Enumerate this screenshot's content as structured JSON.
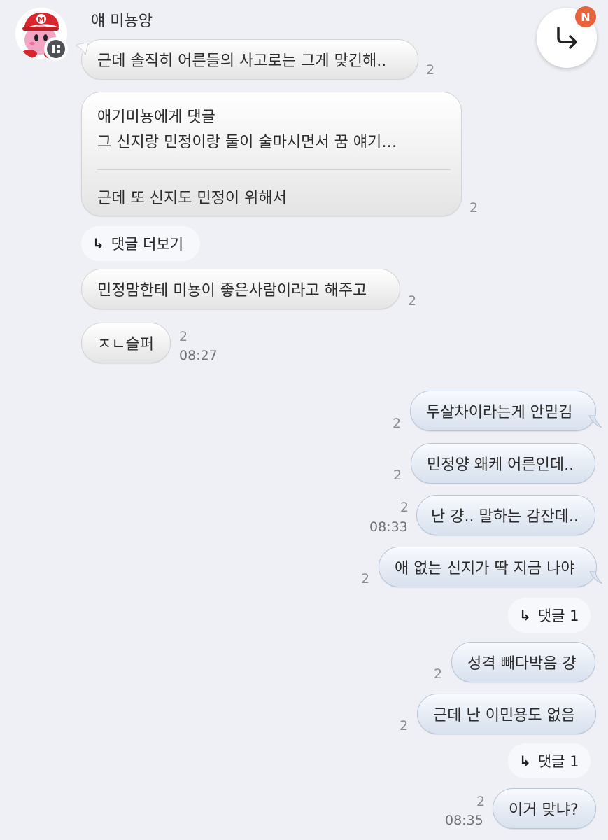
{
  "sender": {
    "name": "얘 미뇽앙"
  },
  "incoming": [
    {
      "text": "근데 솔직히 어른들의 사고로는 그게 맞긴해..",
      "count": "2"
    },
    {
      "comment_title": "애기미뇽에게 댓글",
      "comment_quote": "그 신지랑 민정이랑 둘이 술마시면서 꿈 얘기…",
      "text": "근데 또 신지도 민정이 위해서",
      "count": "2"
    },
    {
      "text": "민정맘한테 미뇽이 좋은사람이라고 해주고",
      "count": "2"
    },
    {
      "text": "ㅈㄴ슬퍼",
      "count": "2",
      "time": "08:27"
    }
  ],
  "more_comments": "댓글 더보기",
  "outgoing": [
    {
      "text": "두살차이라는게 안믿김",
      "count": "2"
    },
    {
      "text": "민정양 왜케 어른인데..",
      "count": "2"
    },
    {
      "text": "난 걍.. 말하는 감잔데..",
      "count": "2",
      "time": "08:33"
    },
    {
      "text": "애 없는 신지가 딱 지금 나야",
      "count": "2"
    },
    {
      "text": "성격 빼다박음 걍",
      "count": "2"
    },
    {
      "text": "근데 난 이민용도 없음",
      "count": "2"
    },
    {
      "text": "이거 맞냐?",
      "count": "2",
      "time": "08:35"
    }
  ],
  "reply_pills": [
    "댓글 1",
    "댓글 1"
  ],
  "arrow_glyph": "↳",
  "fab": {
    "badge": "N",
    "icon": "reply-arrow-icon"
  },
  "colors": {
    "badge": "#e8623c",
    "background": "#eef0f5"
  }
}
